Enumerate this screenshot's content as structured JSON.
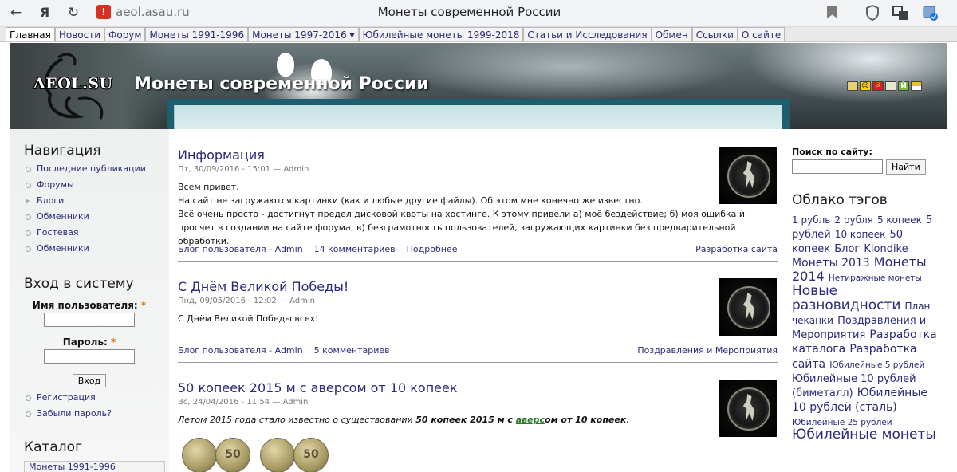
{
  "browser": {
    "url": "aeol.asau.ru",
    "title": "Монеты современной России"
  },
  "menu": [
    {
      "label": "Главная",
      "active": true
    },
    {
      "label": "Новости"
    },
    {
      "label": "Форум"
    },
    {
      "label": "Монеты 1991-1996"
    },
    {
      "label": "Монеты 1997-2016 ▾"
    },
    {
      "label": "Юбилейные монеты 1999-2018"
    },
    {
      "label": "Статьи и Исследования"
    },
    {
      "label": "Обмен"
    },
    {
      "label": "Ссылки"
    },
    {
      "label": "О сайте"
    }
  ],
  "header": {
    "logo_text": "AEOL.SU",
    "site_title": "Монеты современной России"
  },
  "left": {
    "nav_title": "Навигация",
    "nav_items": [
      "Последние публикации",
      "Форумы",
      "Блоги",
      "Обменники",
      "Гостевая",
      "Обменники"
    ],
    "login_title": "Вход в систему",
    "username_label": "Имя пользователя:",
    "password_label": "Пароль:",
    "required_mark": "*",
    "login_button": "Вход",
    "register_link": "Регистрация",
    "forgot_link": "Забыли пароль?",
    "catalog_title": "Каталог",
    "catalog_first": "Монеты 1991-1996"
  },
  "posts": [
    {
      "title": "Информация",
      "meta": "Пт, 30/09/2016 - 15:01 — Admin",
      "body": [
        "Всем привет.",
        "На сайт не загружаются картинки (как и любые другие файлы). Об этом мне конечно же известно.",
        "Всё очень просто - достигнут предел дисковой квоты на хостинге. К этому привели а) моё бездействие; б) моя ошибка и просчет в создании на сайте форума; в) безграмотность пользователей, загружающих картинки без предварительной обработки."
      ],
      "blog_link": "Блог пользователя - Admin",
      "comments": "14 комментариев",
      "more": "Подробнее",
      "term": "Разработка сайта"
    },
    {
      "title": "С Днём Великой Победы!",
      "meta": "Пнд, 09/05/2016 - 12:02 — Admin",
      "body": [
        "С Днём Великой Победы всех!"
      ],
      "blog_link": "Блог пользователя - Admin",
      "comments": "5 комментариев",
      "term": "Поздравления и Мероприятия"
    },
    {
      "title": "50 копеек 2015 м с аверсом от 10 копеек",
      "meta": "Вс, 24/04/2016 - 11:54 — Admin",
      "body_pre": "Летом 2015 года стало известно о существовании ",
      "body_bold_pre": "50 копеек 2015 м с ",
      "body_link": "аверс",
      "body_bold_post": "ом от 10 копеек",
      "body_end": "."
    }
  ],
  "coins": [
    "50",
    "50"
  ],
  "right": {
    "search_label": "Поиск по сайту:",
    "search_value": "",
    "search_button": "Найти",
    "tags_title": "Облако тэгов",
    "tags": [
      {
        "text": "1 рубль",
        "size": "t1"
      },
      {
        "text": "2 рубля",
        "size": "t1"
      },
      {
        "text": "5 копеек",
        "size": "t1"
      },
      {
        "text": "5 рублей",
        "size": "t2"
      },
      {
        "text": "10 копеек",
        "size": "t1"
      },
      {
        "text": "50 копеек",
        "size": "t2"
      },
      {
        "text": "Блог",
        "size": "t2"
      },
      {
        "text": "Klondike",
        "size": "t2"
      },
      {
        "text": "Монеты 2013",
        "size": "t3"
      },
      {
        "text": "Монеты 2014",
        "size": "t4"
      },
      {
        "text": "Нетиражные монеты",
        "size": "t6"
      },
      {
        "text": "Новые разновидности",
        "size": "t5"
      },
      {
        "text": "План чеканки",
        "size": "t1"
      },
      {
        "text": "Поздравления и Мероприятия",
        "size": "t2"
      },
      {
        "text": "Разработка каталога",
        "size": "t3"
      },
      {
        "text": "Разработка сайта",
        "size": "t3"
      },
      {
        "text": "Юбилейные 5 рублей",
        "size": "t6"
      },
      {
        "text": "Юбилейные 10 рублей (биметалл)",
        "size": "t2"
      },
      {
        "text": "Юбилейные 10 рублей (сталь)",
        "size": "t3"
      },
      {
        "text": "Юбилейные 25 рублей",
        "size": "t6"
      },
      {
        "text": "Юбилейные монеты",
        "size": "t5"
      }
    ]
  },
  "colors": {
    "link": "#2a2a7a",
    "teal": "#1e5e6e",
    "required": "#e07000"
  }
}
